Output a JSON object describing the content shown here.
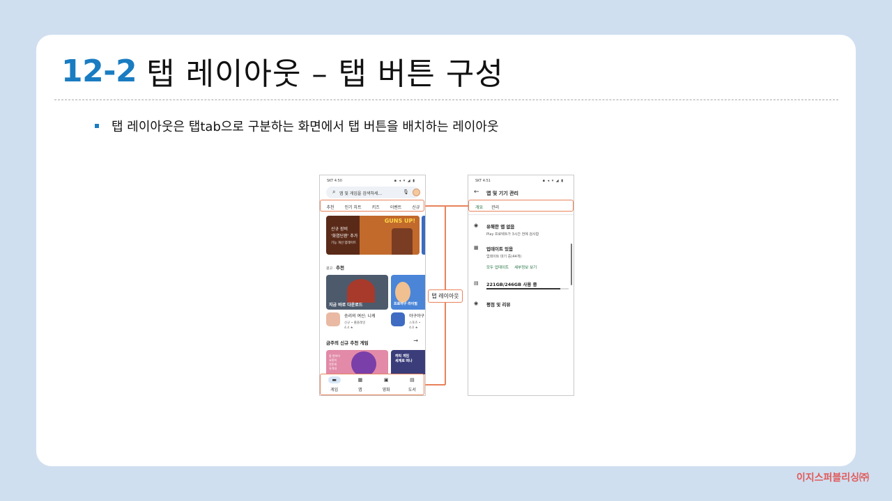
{
  "slide": {
    "title_number": "12-2",
    "title_text": "탭 레이아웃 – 탭 버튼 구성",
    "bullet": "탭 레이아웃은 탭tab으로 구분하는 화면에서 탭 버튼을 배치하는 레이아웃",
    "callout_label": "탭 레이아웃",
    "publisher": "이지스퍼블리싱㈜",
    "colors": {
      "accent": "#1a7cc1",
      "highlight": "#e8825a",
      "background": "#cfdff0",
      "publisher": "#e15a5a"
    }
  },
  "phone1": {
    "status_time": "SKT 4:50",
    "status_icons": "▪ ◂ ▾ ◢ ▮",
    "search_placeholder": "앱 및 게임을 검색하세...",
    "icons": {
      "search": "search-icon",
      "mic": "mic-icon",
      "avatar": "avatar"
    },
    "tabs": [
      "추천",
      "인기 차트",
      "키즈",
      "이벤트",
      "신규"
    ],
    "banner": {
      "line1": "신규 장비",
      "line2": "'화염단환' 추가",
      "line3": "기능 개선 업데이트",
      "logo": "GUNS UP!"
    },
    "section1": {
      "prefix": "광고 · ",
      "title": "추천"
    },
    "game1_caption": "지금 바로 다운로드",
    "game2_caption": "프로야구 라이벌",
    "app1": {
      "name": "승리의 여신: 니케",
      "sub": "신규 • 롤플레잉",
      "rating": "4.4 ★"
    },
    "app2": {
      "name": "야구야구",
      "sub": "스포츠 •",
      "rating": "4.0 ★"
    },
    "section2": {
      "title": "금주의 신규 추천 게임",
      "arrow": "→"
    },
    "game3_caption": "좀 편이어\n요정의\n전투에\n유격대",
    "game4_caption": "캐릭 게임\n세계로 떠나",
    "nav": [
      {
        "label": "게임",
        "icon": "gamepad-icon"
      },
      {
        "label": "앱",
        "icon": "apps-icon"
      },
      {
        "label": "영화",
        "icon": "movie-icon"
      },
      {
        "label": "도서",
        "icon": "book-icon"
      }
    ]
  },
  "phone2": {
    "status_time": "SKT 4:51",
    "status_icons": "▪ ◂ ▾ ◢ ▮",
    "title": "앱 및 기기 관리",
    "tabs": [
      "개요",
      "관리"
    ],
    "items": [
      {
        "title": "유해한 앱 없음",
        "sub": "Play 프로텍트가 3시간 전에 검사함",
        "icon": "shield-icon"
      },
      {
        "title": "업데이트 있음",
        "sub": "업데이트 대기 중(44개)",
        "icon": "apps-icon"
      },
      {
        "title": "221GB/246GB 사용 중",
        "sub": "",
        "icon": "storage-icon"
      },
      {
        "title": "평점 및 리뷰",
        "sub": "",
        "icon": "star-icon"
      }
    ],
    "update_links": [
      "모두 업데이트",
      "세부정보 보기"
    ],
    "storage_used_fraction": 0.898
  }
}
